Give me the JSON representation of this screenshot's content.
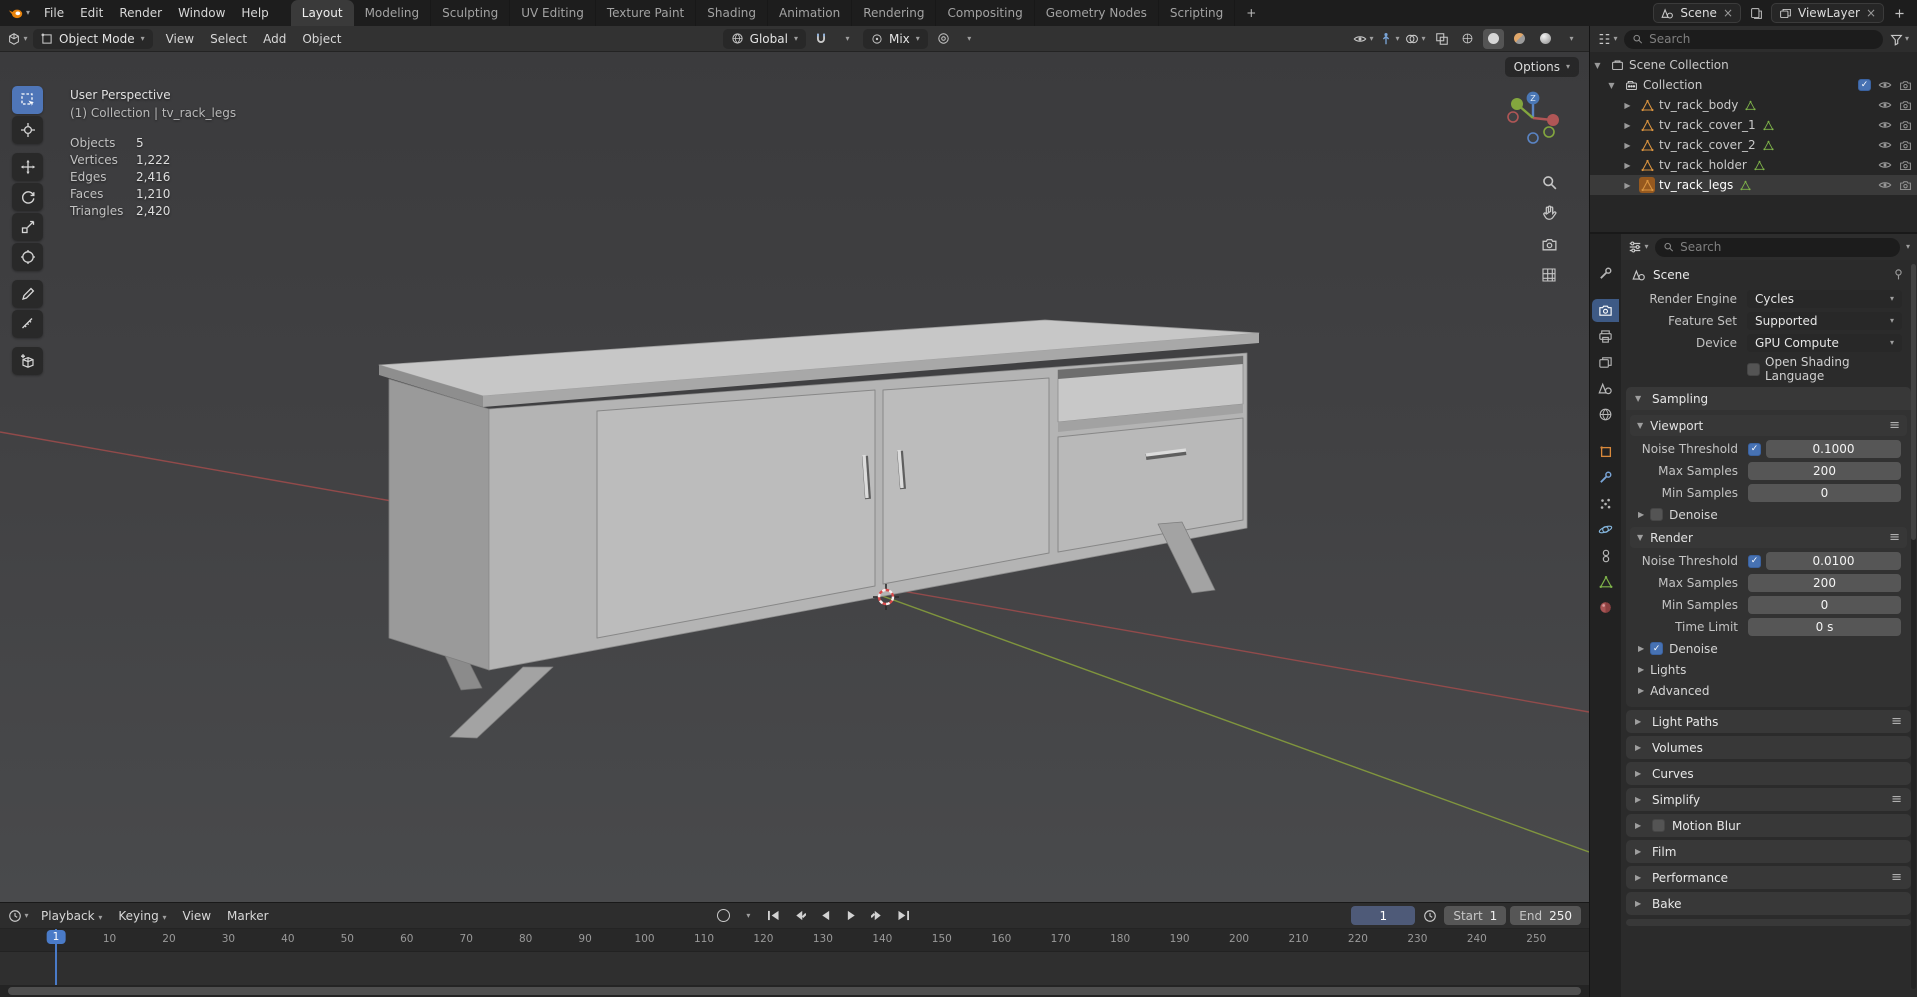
{
  "colors": {
    "accent_blue": "#4772b3",
    "accent_orange": "#e8830c",
    "axis_red": "#a04c4c",
    "axis_green": "#8aa33c"
  },
  "topbar": {
    "menus": [
      "File",
      "Edit",
      "Render",
      "Window",
      "Help"
    ],
    "workspaces": [
      {
        "label": "Layout",
        "active": true
      },
      {
        "label": "Modeling"
      },
      {
        "label": "Sculpting"
      },
      {
        "label": "UV Editing"
      },
      {
        "label": "Texture Paint"
      },
      {
        "label": "Shading"
      },
      {
        "label": "Animation"
      },
      {
        "label": "Rendering"
      },
      {
        "label": "Compositing"
      },
      {
        "label": "Geometry Nodes"
      },
      {
        "label": "Scripting"
      }
    ],
    "add_workspace_label": "+",
    "scene_name": "Scene",
    "viewlayer_name": "ViewLayer"
  },
  "viewport_header": {
    "mode": "Object Mode",
    "menus": [
      "View",
      "Select",
      "Add",
      "Object"
    ],
    "orientation": "Global",
    "pivot": "Mix",
    "options_label": "Options"
  },
  "viewport": {
    "view_label": "User Perspective",
    "context_label": "(1) Collection | tv_rack_legs",
    "stats": [
      {
        "label": "Objects",
        "value": "5"
      },
      {
        "label": "Vertices",
        "value": "1,222"
      },
      {
        "label": "Edges",
        "value": "2,416"
      },
      {
        "label": "Faces",
        "value": "1,210"
      },
      {
        "label": "Triangles",
        "value": "2,420"
      }
    ],
    "gizmo_z_label": "Z"
  },
  "outliner": {
    "search_placeholder": "Search",
    "scene_collection_label": "Scene Collection",
    "collection_label": "Collection",
    "objects": [
      {
        "name": "tv_rack_body"
      },
      {
        "name": "tv_rack_cover_1"
      },
      {
        "name": "tv_rack_cover_2"
      },
      {
        "name": "tv_rack_holder"
      },
      {
        "name": "tv_rack_legs",
        "active": true
      }
    ]
  },
  "properties": {
    "search_placeholder": "Search",
    "breadcrumb": "Scene",
    "render_engine": {
      "label": "Render Engine",
      "value": "Cycles"
    },
    "feature_set": {
      "label": "Feature Set",
      "value": "Supported"
    },
    "device": {
      "label": "Device",
      "value": "GPU Compute"
    },
    "osl_label": "Open Shading Language",
    "sampling": {
      "title": "Sampling",
      "viewport": {
        "title": "Viewport",
        "noise_threshold_label": "Noise Threshold",
        "noise_threshold_value": "0.1000",
        "max_samples_label": "Max Samples",
        "max_samples_value": "200",
        "min_samples_label": "Min Samples",
        "min_samples_value": "0",
        "denoise_label": "Denoise"
      },
      "render": {
        "title": "Render",
        "noise_threshold_label": "Noise Threshold",
        "noise_threshold_value": "0.0100",
        "max_samples_label": "Max Samples",
        "max_samples_value": "200",
        "min_samples_label": "Min Samples",
        "min_samples_value": "0",
        "time_limit_label": "Time Limit",
        "time_limit_value": "0 s",
        "denoise_label": "Denoise"
      },
      "lights_label": "Lights",
      "advanced_label": "Advanced"
    },
    "sections": [
      {
        "label": "Light Paths",
        "menu": true
      },
      {
        "label": "Volumes"
      },
      {
        "label": "Curves"
      },
      {
        "label": "Simplify",
        "menu": true
      },
      {
        "label": "Motion Blur",
        "checkbox": true
      },
      {
        "label": "Film"
      },
      {
        "label": "Performance",
        "menu": true
      },
      {
        "label": "Bake"
      }
    ]
  },
  "timeline": {
    "menus": [
      {
        "label": "Playback",
        "caret": true
      },
      {
        "label": "Keying",
        "caret": true
      },
      {
        "label": "View"
      },
      {
        "label": "Marker"
      }
    ],
    "current_frame": "1",
    "playhead_label": "1",
    "start_label": "Start",
    "start_value": "1",
    "end_label": "End",
    "end_value": "250",
    "ticks": [
      "10",
      "20",
      "30",
      "40",
      "50",
      "60",
      "70",
      "80",
      "90",
      "100",
      "110",
      "120",
      "130",
      "140",
      "150",
      "160",
      "170",
      "180",
      "190",
      "200",
      "210",
      "220",
      "230",
      "240",
      "250"
    ]
  }
}
